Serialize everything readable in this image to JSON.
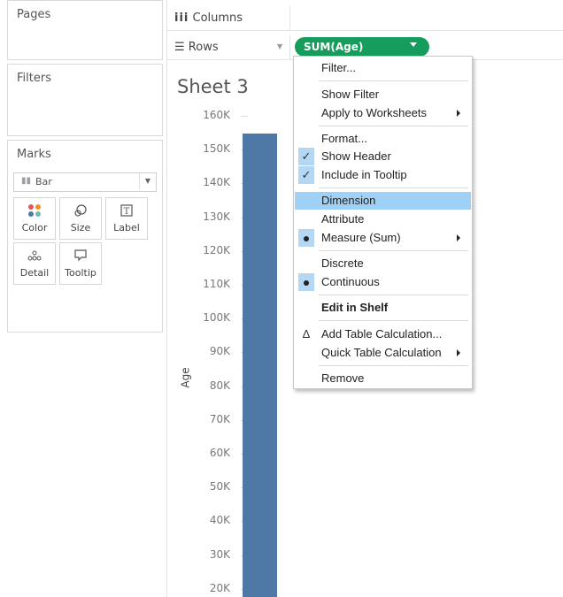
{
  "sidebar": {
    "pages_title": "Pages",
    "filters_title": "Filters",
    "marks_title": "Marks",
    "mark_type": "Bar",
    "mark_buttons": [
      "Color",
      "Size",
      "Label",
      "Detail",
      "Tooltip"
    ]
  },
  "shelves": {
    "columns_label": "Columns",
    "rows_label": "Rows",
    "rows_pill": "SUM(Age)"
  },
  "sheet": {
    "title": "Sheet 3",
    "axis_title": "Age"
  },
  "chart_data": {
    "type": "bar",
    "title": "Sheet 3",
    "ylabel": "Age",
    "y_ticks": [
      "160K",
      "150K",
      "140K",
      "130K",
      "120K",
      "110K",
      "100K",
      "90K",
      "80K",
      "70K",
      "60K",
      "50K",
      "40K",
      "30K",
      "20K"
    ],
    "values": [
      155000
    ],
    "ylim": [
      20000,
      160000
    ],
    "colors": {
      "bar": "#4e79a7"
    }
  },
  "menu": {
    "filter": "Filter...",
    "show_filter": "Show Filter",
    "apply_to_worksheets": "Apply to Worksheets",
    "format": "Format...",
    "show_header": "Show Header",
    "include_in_tooltip": "Include in Tooltip",
    "dimension": "Dimension",
    "attribute": "Attribute",
    "measure_sum": "Measure (Sum)",
    "discrete": "Discrete",
    "continuous": "Continuous",
    "edit_in_shelf": "Edit in Shelf",
    "add_table_calc": "Add Table Calculation...",
    "quick_table_calc": "Quick Table Calculation",
    "remove": "Remove"
  },
  "colors": {
    "pill": "#169c5c",
    "highlight": "#9fd0f5",
    "bar": "#4e79a7"
  }
}
